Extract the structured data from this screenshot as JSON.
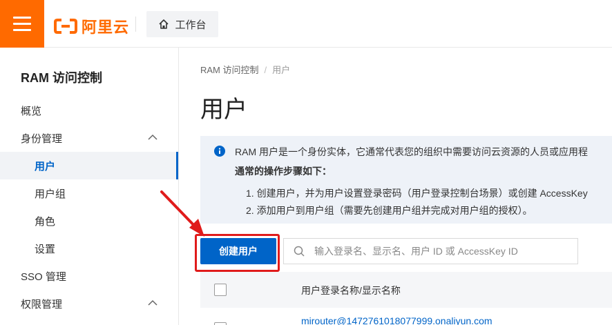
{
  "header": {
    "logo_text": "阿里云",
    "workbench_label": "工作台",
    "brand_color": "#ff6a00"
  },
  "sidebar": {
    "title": "RAM 访问控制",
    "items": [
      {
        "label": "概览",
        "level": "top"
      },
      {
        "label": "身份管理",
        "level": "top",
        "expanded": true
      },
      {
        "label": "用户",
        "level": "sub",
        "active": true
      },
      {
        "label": "用户组",
        "level": "sub"
      },
      {
        "label": "角色",
        "level": "sub"
      },
      {
        "label": "设置",
        "level": "sub"
      },
      {
        "label": "SSO 管理",
        "level": "top"
      },
      {
        "label": "权限管理",
        "level": "top",
        "expanded": true
      }
    ]
  },
  "breadcrumb": [
    "RAM 访问控制",
    "用户"
  ],
  "page_title": "用户",
  "notice": {
    "line1": "RAM 用户是一个身份实体，它通常代表您的组织中需要访问云资源的人员或应用程",
    "line2": "通常的操作步骤如下：",
    "step1": "1. 创建用户，并为用户设置登录密码（用户登录控制台场景）或创建 AccessKey",
    "step2": "2. 添加用户到用户组（需要先创建用户组并完成对用户组的授权）。"
  },
  "actions": {
    "create_user_label": "创建用户",
    "search_placeholder": "输入登录名、显示名、用户 ID 或 AccessKey ID"
  },
  "table": {
    "column_header": "用户登录名称/显示名称",
    "rows": [
      {
        "login": "mirouter@1472761018077999.onaliyun.com"
      }
    ]
  },
  "colors": {
    "accent": "#0064c8",
    "annotation_red": "#e01b1b"
  }
}
